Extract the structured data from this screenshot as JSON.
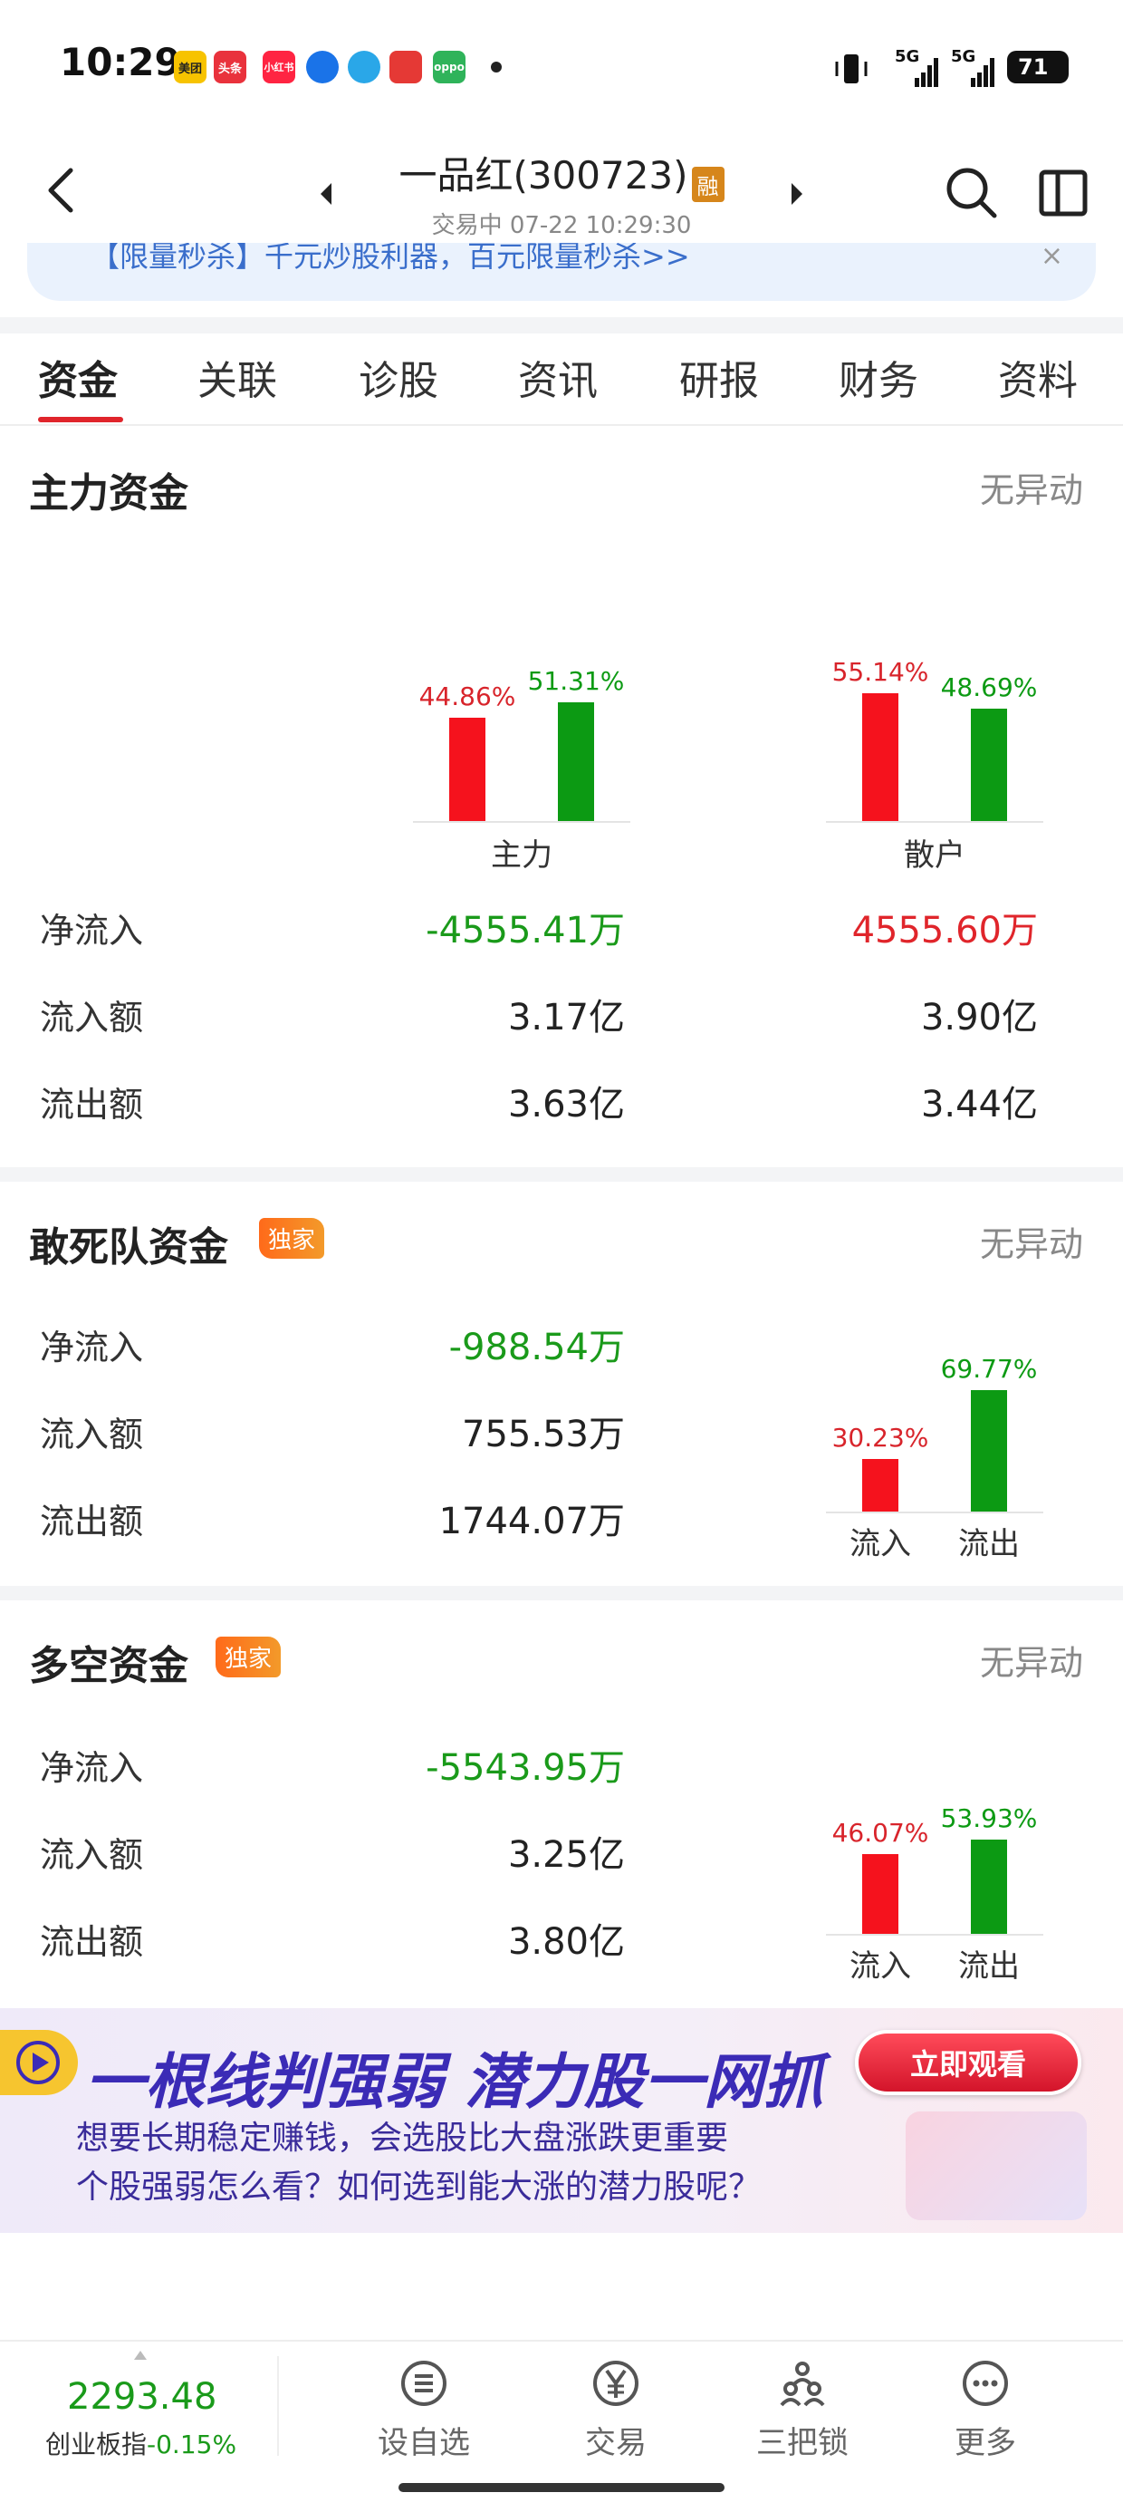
{
  "status_bar": {
    "time": "10:29",
    "apps": [
      {
        "name": "meituan",
        "label": "美团",
        "color": "#f7c300"
      },
      {
        "name": "toutiao",
        "label": "头条",
        "color": "#e9323c"
      },
      {
        "name": "xiaohongshu",
        "label": "小红书",
        "color": "#ff2442"
      },
      {
        "name": "app-blue",
        "label": "",
        "color": "#1a73e8"
      },
      {
        "name": "telegram",
        "label": "",
        "color": "#2aa7e8"
      },
      {
        "name": "app-red",
        "label": "",
        "color": "#e53935"
      },
      {
        "name": "oppo",
        "label": "oppo",
        "color": "#2fb35a"
      }
    ],
    "signal_1": "5G",
    "signal_2": "5G",
    "battery": "71"
  },
  "header": {
    "title": "一品红(300723)",
    "badge": "融",
    "subtitle": "交易中 07-22 10:29:30"
  },
  "notice": {
    "text": "【限量秒杀】千元炒股利器，百元限量秒杀>>",
    "close": "×"
  },
  "tabs": [
    "资金",
    "关联",
    "诊股",
    "资讯",
    "研报",
    "财务",
    "资料"
  ],
  "main_fund": {
    "title": "主力资金",
    "status": "无异动",
    "groups": [
      {
        "label": "主力",
        "inflow_pct": "44.86%",
        "outflow_pct": "51.31%",
        "inflow_value": 44.86,
        "outflow_value": 51.31
      },
      {
        "label": "散户",
        "inflow_pct": "55.14%",
        "outflow_pct": "48.69%",
        "inflow_value": 55.14,
        "outflow_value": 48.69
      }
    ],
    "rows": [
      {
        "label": "净流入",
        "main": "-4555.41万",
        "retail": "4555.60万"
      },
      {
        "label": "流入额",
        "main": "3.17亿",
        "retail": "3.90亿"
      },
      {
        "label": "流出额",
        "main": "3.63亿",
        "retail": "3.44亿"
      }
    ]
  },
  "dare_fund": {
    "title": "敢死队资金",
    "badge": "独家",
    "status": "无异动",
    "rows": [
      {
        "label": "净流入",
        "value": "-988.54万"
      },
      {
        "label": "流入额",
        "value": "755.53万"
      },
      {
        "label": "流出额",
        "value": "1744.07万"
      }
    ],
    "bars": {
      "in_label": "流入",
      "out_label": "流出",
      "in_pct": "30.23%",
      "out_pct": "69.77%",
      "in_value": 30.23,
      "out_value": 69.77
    }
  },
  "longshort_fund": {
    "title": "多空资金",
    "badge": "独家",
    "status": "无异动",
    "rows": [
      {
        "label": "净流入",
        "value": "-5543.95万"
      },
      {
        "label": "流入额",
        "value": "3.25亿"
      },
      {
        "label": "流出额",
        "value": "3.80亿"
      }
    ],
    "bars": {
      "in_label": "流入",
      "out_label": "流出",
      "in_pct": "46.07%",
      "out_pct": "53.93%",
      "in_value": 46.07,
      "out_value": 53.93
    }
  },
  "ad": {
    "headline": "一根线判强弱 潜力股一网抓",
    "button": "立即观看",
    "line1": "想要长期稳定赚钱，会选股比大盘涨跌更重要",
    "line2": "个股强弱怎么看？如何选到能大涨的潜力股呢？"
  },
  "bottom_nav": {
    "index_value": "2293.48",
    "index_name": "创业板指",
    "index_change": "-0.15%",
    "items": [
      {
        "label": "设自选",
        "icon": "list-icon"
      },
      {
        "label": "交易",
        "icon": "yen-icon"
      },
      {
        "label": "三把锁",
        "icon": "people-icon"
      },
      {
        "label": "更多",
        "icon": "more-icon"
      }
    ]
  }
}
